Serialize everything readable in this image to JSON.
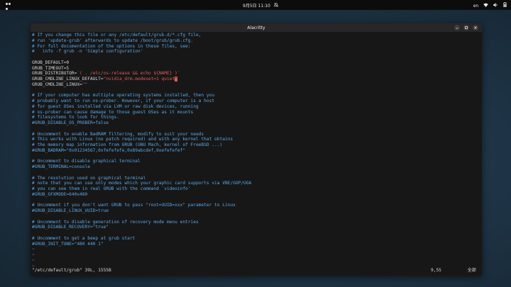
{
  "topbar": {
    "clock": "9月5日  11:10",
    "input_method": "en"
  },
  "window": {
    "title": "Alacritty"
  },
  "editor": {
    "lines": [
      {
        "kind": "comment",
        "text": "# If you change this file or any /etc/default/grub.d/*.cfg file,"
      },
      {
        "kind": "comment",
        "text": "# run 'update-grub' afterwards to update /boot/grub/grub.cfg."
      },
      {
        "kind": "comment",
        "text": "# For full documentation of the options in these files, see:"
      },
      {
        "kind": "comment",
        "text": "#   info -f grub -n 'Simple configuration'"
      },
      {
        "kind": "blank",
        "text": ""
      },
      {
        "kind": "text",
        "text": "GRUB_DEFAULT=0"
      },
      {
        "kind": "text",
        "text": "GRUB_TIMEOUT=5"
      },
      {
        "kind": "mixed",
        "text": "GRUB_DISTRIBUTOR=",
        "str": "`( . /etc/os-release && echo ${NAME} )`"
      },
      {
        "kind": "mixed",
        "text": "GRUB_CMDLINE_LINUX_DEFAULT=",
        "str": "\"nvidia_drm.modeset=1 quiet",
        "cursor": "\""
      },
      {
        "kind": "mixed",
        "text": "GRUB_CMDLINE_LINUX=",
        "str": "\"\""
      },
      {
        "kind": "blank",
        "text": ""
      },
      {
        "kind": "comment",
        "text": "# If your computer has multiple operating systems installed, then you"
      },
      {
        "kind": "comment",
        "text": "# probably want to run os-prober. However, if your computer is a host"
      },
      {
        "kind": "comment",
        "text": "# for guest OSes installed via LVM or raw disk devices, running"
      },
      {
        "kind": "comment",
        "text": "# os-prober can cause damage to those guest OSes as it mounts"
      },
      {
        "kind": "comment",
        "text": "# filesystems to look for things."
      },
      {
        "kind": "comment",
        "text": "#GRUB_DISABLE_OS_PROBER=false"
      },
      {
        "kind": "blank",
        "text": ""
      },
      {
        "kind": "comment",
        "text": "# Uncomment to enable BadRAM filtering, modify to suit your needs"
      },
      {
        "kind": "comment",
        "text": "# This works with Linux (no patch required) and with any kernel that obtains"
      },
      {
        "kind": "comment",
        "text": "# the memory map information from GRUB (GNU Mach, kernel of FreeBSD ...)"
      },
      {
        "kind": "comment",
        "text": "#GRUB_BADRAM=\"0x01234567,0xfefefefe,0x89abcdef,0xefefefef\""
      },
      {
        "kind": "blank",
        "text": ""
      },
      {
        "kind": "comment",
        "text": "# Uncomment to disable graphical terminal"
      },
      {
        "kind": "comment",
        "text": "#GRUB_TERMINAL=console"
      },
      {
        "kind": "blank",
        "text": ""
      },
      {
        "kind": "comment",
        "text": "# The resolution used on graphical terminal"
      },
      {
        "kind": "comment",
        "text": "# note that you can use only modes which your graphic card supports via VBE/GOP/UGA"
      },
      {
        "kind": "comment",
        "text": "# you can see them in real GRUB with the command `videoinfo'"
      },
      {
        "kind": "comment",
        "text": "#GRUB_GFXMODE=640x480"
      },
      {
        "kind": "blank",
        "text": ""
      },
      {
        "kind": "comment",
        "text": "# Uncomment if you don't want GRUB to pass \"root=UUID=xxx\" parameter to Linux"
      },
      {
        "kind": "comment",
        "text": "#GRUB_DISABLE_LINUX_UUID=true"
      },
      {
        "kind": "blank",
        "text": ""
      },
      {
        "kind": "comment",
        "text": "# Uncomment to disable generation of recovery mode menu entries"
      },
      {
        "kind": "comment",
        "text": "#GRUB_DISABLE_RECOVERY=\"true\""
      },
      {
        "kind": "blank",
        "text": ""
      },
      {
        "kind": "comment",
        "text": "# Uncomment to get a beep at grub start"
      },
      {
        "kind": "comment",
        "text": "#GRUB_INIT_TUNE=\"480 440 1\""
      },
      {
        "kind": "tilde",
        "text": "~"
      },
      {
        "kind": "tilde",
        "text": "~"
      },
      {
        "kind": "tilde",
        "text": "~"
      },
      {
        "kind": "tilde",
        "text": "~"
      }
    ]
  },
  "status": {
    "file": "\"/etc/default/grub\" 39L, 1555B",
    "position": "9,55",
    "scroll": "全部"
  }
}
